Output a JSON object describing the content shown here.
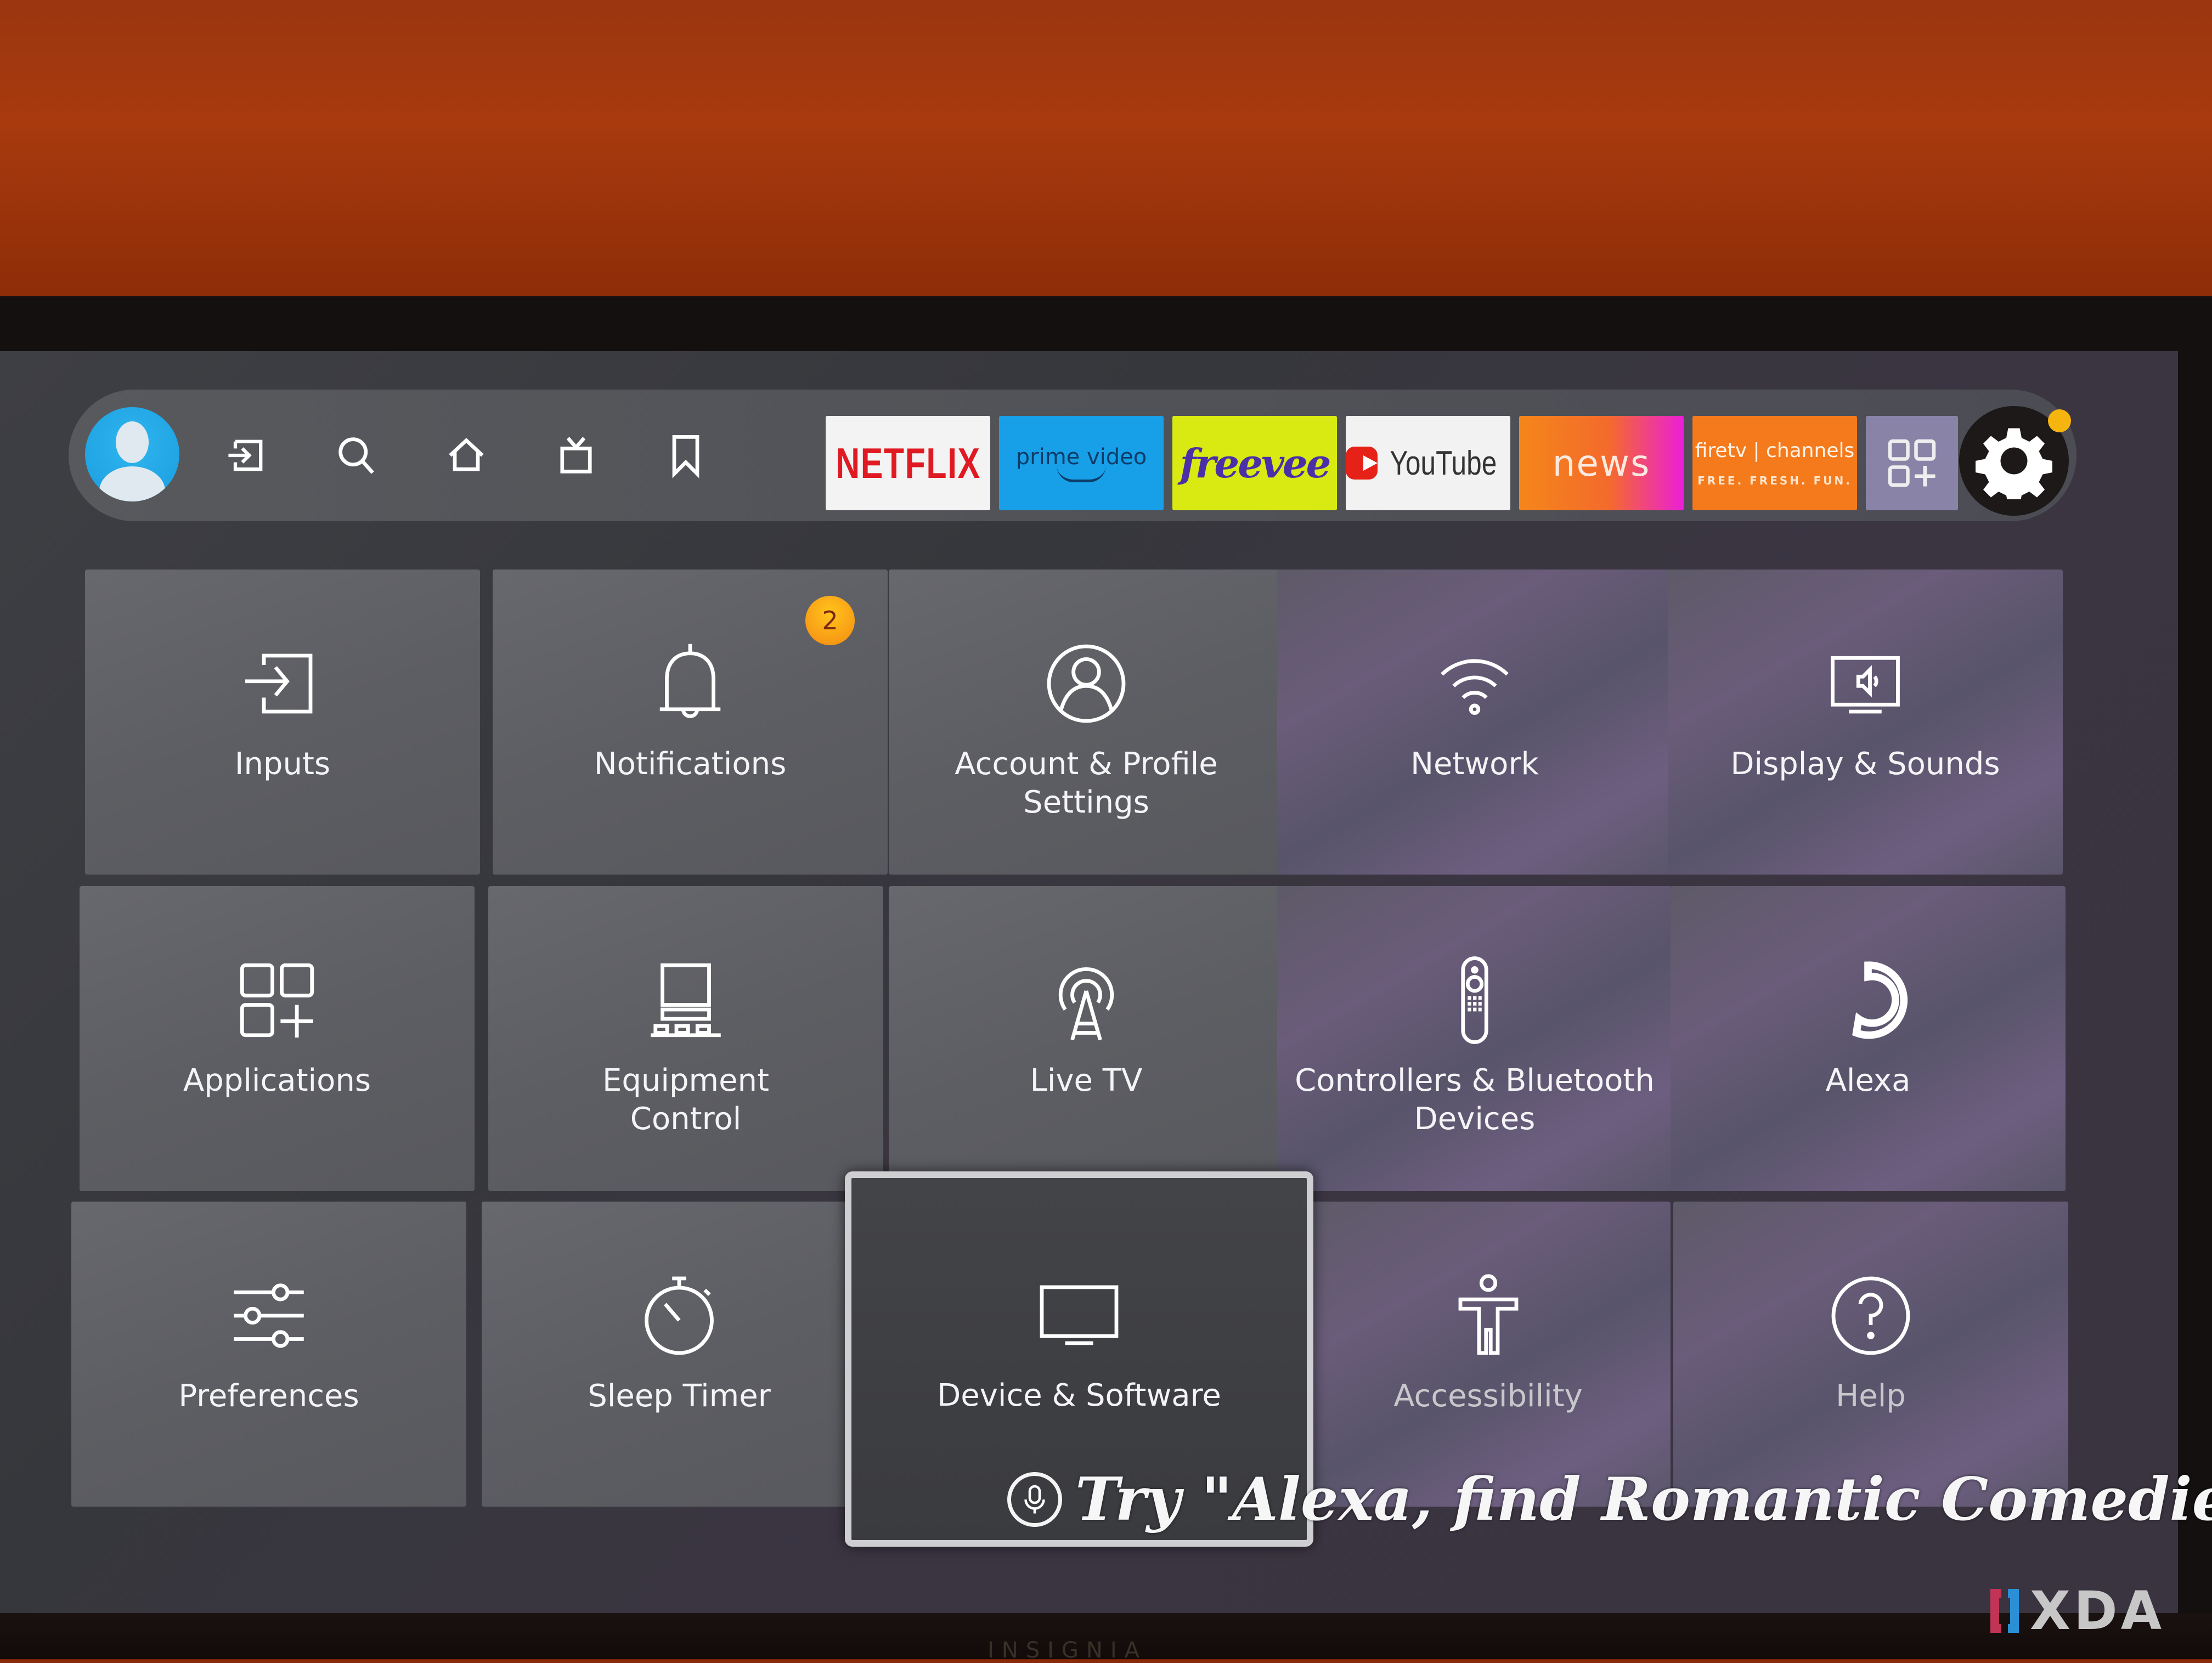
{
  "nav": {
    "items": [
      {
        "name": "profile",
        "icon": "profile-avatar-icon"
      },
      {
        "name": "inputs",
        "icon": "input-icon"
      },
      {
        "name": "search",
        "icon": "search-icon"
      },
      {
        "name": "home",
        "icon": "home-icon"
      },
      {
        "name": "live",
        "icon": "tv-icon"
      },
      {
        "name": "watchlist",
        "icon": "bookmark-icon"
      }
    ],
    "apps": [
      {
        "name": "netflix",
        "label": "NETFLIX",
        "color": "#e01a22"
      },
      {
        "name": "prime-video",
        "label": "prime video",
        "color": "#17a0e8"
      },
      {
        "name": "freevee",
        "label": "freevee",
        "color": "#d8ea12"
      },
      {
        "name": "youtube",
        "label": "YouTube",
        "color": "#e62117"
      },
      {
        "name": "news",
        "label": "news",
        "color": "#f5861a"
      },
      {
        "name": "firetv-channels",
        "label": "firetv | channels",
        "tagline": "FREE. FRESH. FUN.",
        "color": "#f47a1c"
      },
      {
        "name": "apps",
        "label": "",
        "icon": "apps-grid-icon"
      }
    ],
    "settings": {
      "icon": "gear-icon",
      "has_notification_dot": true,
      "dot_color": "#f5b40e"
    }
  },
  "settings_tiles": [
    {
      "id": "inputs",
      "label": "Inputs",
      "icon": "input-icon"
    },
    {
      "id": "notifications",
      "label": "Notifications",
      "icon": "bell-icon",
      "badge": "2"
    },
    {
      "id": "account",
      "label": "Account & Profile Settings",
      "icon": "account-icon"
    },
    {
      "id": "network",
      "label": "Network",
      "icon": "wifi-icon"
    },
    {
      "id": "display",
      "label": "Display & Sounds",
      "icon": "display-sound-icon"
    },
    {
      "id": "applications",
      "label": "Applications",
      "icon": "apps-grid-icon"
    },
    {
      "id": "equipment",
      "label": "Equipment Control",
      "icon": "equipment-icon"
    },
    {
      "id": "livetv",
      "label": "Live TV",
      "icon": "antenna-icon"
    },
    {
      "id": "controllers",
      "label": "Controllers & Bluetooth Devices",
      "icon": "remote-icon"
    },
    {
      "id": "alexa",
      "label": "Alexa",
      "icon": "alexa-icon"
    },
    {
      "id": "preferences",
      "label": "Preferences",
      "icon": "sliders-icon"
    },
    {
      "id": "sleeptimer",
      "label": "Sleep Timer",
      "icon": "stopwatch-icon"
    },
    {
      "id": "device",
      "label": "Device & Software",
      "icon": "tv-monitor-icon",
      "focused": true
    },
    {
      "id": "accessibility",
      "label": "Accessibility",
      "icon": "accessibility-icon"
    },
    {
      "id": "help",
      "label": "Help",
      "icon": "help-icon"
    }
  ],
  "alexa_hint": {
    "text": "Try \"Alexa, find Romantic Comedies\"",
    "icon": "microphone-icon"
  },
  "watermark": "XDA",
  "tv_brand": "INSIGNIA"
}
